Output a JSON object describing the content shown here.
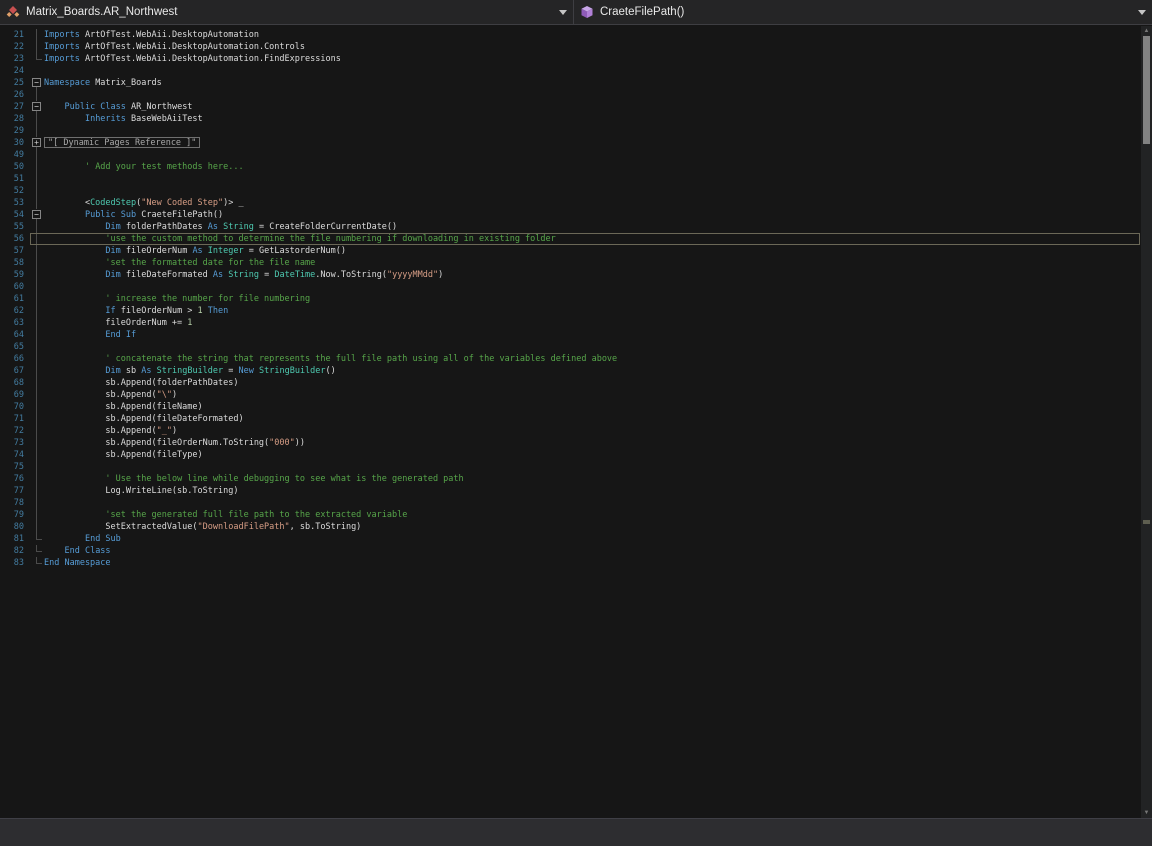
{
  "navbar": {
    "left": {
      "label": "Matrix_Boards.AR_Northwest",
      "icon": "class-icon"
    },
    "right": {
      "label": "CraeteFilePath()",
      "icon": "method-icon"
    }
  },
  "colors": {
    "keyword": "#569cd6",
    "type": "#4ec9b0",
    "string": "#d69d85",
    "comment": "#57a64a",
    "number": "#b5cea8",
    "plain": "#dcdcdc",
    "line_number": "#437ca0",
    "current_line_border": "#6b6857",
    "editor_background": "#161616"
  },
  "editor": {
    "current_line": 56,
    "collapsed_region_text": "\"[ Dynamic Pages Reference ]\"",
    "lines": [
      {
        "num": 21,
        "fold": "line",
        "segs": [
          [
            "k",
            "Imports "
          ],
          [
            "p",
            "ArtOfTest.WebAii.DesktopAutomation"
          ]
        ]
      },
      {
        "num": 22,
        "fold": "line",
        "segs": [
          [
            "k",
            "Imports "
          ],
          [
            "p",
            "ArtOfTest.WebAii.DesktopAutomation.Controls"
          ]
        ]
      },
      {
        "num": 23,
        "fold": "end",
        "segs": [
          [
            "k",
            "Imports "
          ],
          [
            "p",
            "ArtOfTest.WebAii.DesktopAutomation.FindExpressions"
          ]
        ]
      },
      {
        "num": 24,
        "fold": "none",
        "segs": []
      },
      {
        "num": 25,
        "fold": "minus",
        "segs": [
          [
            "k",
            "Namespace "
          ],
          [
            "p",
            "Matrix_Boards"
          ]
        ]
      },
      {
        "num": 26,
        "fold": "line",
        "segs": []
      },
      {
        "num": 27,
        "fold": "minus",
        "segs": [
          [
            "p",
            "    "
          ],
          [
            "k",
            "Public Class "
          ],
          [
            "p",
            "AR_Northwest"
          ]
        ]
      },
      {
        "num": 28,
        "fold": "line",
        "segs": [
          [
            "p",
            "        "
          ],
          [
            "k",
            "Inherits "
          ],
          [
            "p",
            "BaseWebAiiTest"
          ]
        ]
      },
      {
        "num": 29,
        "fold": "line",
        "segs": []
      },
      {
        "num": 30,
        "fold": "plus",
        "collapsed": true,
        "text": "\"[ Dynamic Pages Reference ]\""
      },
      {
        "num": 49,
        "fold": "line",
        "segs": []
      },
      {
        "num": 50,
        "fold": "line",
        "segs": [
          [
            "p",
            "        "
          ],
          [
            "c",
            "' Add your test methods here..."
          ]
        ]
      },
      {
        "num": 51,
        "fold": "line",
        "segs": []
      },
      {
        "num": 52,
        "fold": "line",
        "segs": []
      },
      {
        "num": 53,
        "fold": "line",
        "segs": [
          [
            "p",
            "        <"
          ],
          [
            "t",
            "CodedStep"
          ],
          [
            "p",
            "("
          ],
          [
            "s",
            "\"New Coded Step\""
          ],
          [
            "p",
            ")> _"
          ]
        ]
      },
      {
        "num": 54,
        "fold": "minus",
        "segs": [
          [
            "p",
            "        "
          ],
          [
            "k",
            "Public Sub "
          ],
          [
            "p",
            "CraeteFilePath()"
          ]
        ]
      },
      {
        "num": 55,
        "fold": "line",
        "segs": [
          [
            "p",
            "            "
          ],
          [
            "k",
            "Dim "
          ],
          [
            "p",
            "folderPathDates "
          ],
          [
            "k",
            "As "
          ],
          [
            "t",
            "String"
          ],
          [
            "p",
            " = CreateFolderCurrentDate()"
          ]
        ]
      },
      {
        "num": 56,
        "fold": "line",
        "current": true,
        "segs": [
          [
            "p",
            "            "
          ],
          [
            "c",
            "'use the custom method to determine the file numbering if downloading in existing folder"
          ]
        ]
      },
      {
        "num": 57,
        "fold": "line",
        "segs": [
          [
            "p",
            "            "
          ],
          [
            "k",
            "Dim "
          ],
          [
            "p",
            "fileOrderNum "
          ],
          [
            "k",
            "As "
          ],
          [
            "t",
            "Integer"
          ],
          [
            "p",
            " = GetLastorderNum()"
          ]
        ]
      },
      {
        "num": 58,
        "fold": "line",
        "segs": [
          [
            "p",
            "            "
          ],
          [
            "c",
            "'set the formatted date for the file name"
          ]
        ]
      },
      {
        "num": 59,
        "fold": "line",
        "segs": [
          [
            "p",
            "            "
          ],
          [
            "k",
            "Dim "
          ],
          [
            "p",
            "fileDateFormated "
          ],
          [
            "k",
            "As "
          ],
          [
            "t",
            "String"
          ],
          [
            "p",
            " = "
          ],
          [
            "t",
            "DateTime"
          ],
          [
            "p",
            ".Now.ToString("
          ],
          [
            "s",
            "\"yyyyMMdd\""
          ],
          [
            "p",
            ")"
          ]
        ]
      },
      {
        "num": 60,
        "fold": "line",
        "segs": []
      },
      {
        "num": 61,
        "fold": "line",
        "segs": [
          [
            "p",
            "            "
          ],
          [
            "c",
            "' increase the number for file numbering"
          ]
        ]
      },
      {
        "num": 62,
        "fold": "line",
        "segs": [
          [
            "p",
            "            "
          ],
          [
            "k",
            "If "
          ],
          [
            "p",
            "fileOrderNum > "
          ],
          [
            "n",
            "1"
          ],
          [
            "p",
            " "
          ],
          [
            "k",
            "Then"
          ]
        ]
      },
      {
        "num": 63,
        "fold": "line",
        "segs": [
          [
            "p",
            "            fileOrderNum += "
          ],
          [
            "n",
            "1"
          ]
        ]
      },
      {
        "num": 64,
        "fold": "line",
        "segs": [
          [
            "p",
            "            "
          ],
          [
            "k",
            "End If"
          ]
        ]
      },
      {
        "num": 65,
        "fold": "line",
        "segs": []
      },
      {
        "num": 66,
        "fold": "line",
        "segs": [
          [
            "p",
            "            "
          ],
          [
            "c",
            "' concatenate the string that represents the full file path using all of the variables defined above"
          ]
        ]
      },
      {
        "num": 67,
        "fold": "line",
        "segs": [
          [
            "p",
            "            "
          ],
          [
            "k",
            "Dim "
          ],
          [
            "p",
            "sb "
          ],
          [
            "k",
            "As "
          ],
          [
            "t",
            "StringBuilder"
          ],
          [
            "p",
            " = "
          ],
          [
            "k",
            "New "
          ],
          [
            "t",
            "StringBuilder"
          ],
          [
            "p",
            "()"
          ]
        ]
      },
      {
        "num": 68,
        "fold": "line",
        "segs": [
          [
            "p",
            "            sb.Append(folderPathDates)"
          ]
        ]
      },
      {
        "num": 69,
        "fold": "line",
        "segs": [
          [
            "p",
            "            sb.Append("
          ],
          [
            "s",
            "\"\\\""
          ],
          [
            "p",
            ")"
          ]
        ]
      },
      {
        "num": 70,
        "fold": "line",
        "segs": [
          [
            "p",
            "            sb.Append(fileName)"
          ]
        ]
      },
      {
        "num": 71,
        "fold": "line",
        "segs": [
          [
            "p",
            "            sb.Append(fileDateFormated)"
          ]
        ]
      },
      {
        "num": 72,
        "fold": "line",
        "segs": [
          [
            "p",
            "            sb.Append("
          ],
          [
            "s",
            "\"_\""
          ],
          [
            "p",
            ")"
          ]
        ]
      },
      {
        "num": 73,
        "fold": "line",
        "segs": [
          [
            "p",
            "            sb.Append(fileOrderNum.ToString("
          ],
          [
            "s",
            "\"000\""
          ],
          [
            "p",
            "))"
          ]
        ]
      },
      {
        "num": 74,
        "fold": "line",
        "segs": [
          [
            "p",
            "            sb.Append(fileType)"
          ]
        ]
      },
      {
        "num": 75,
        "fold": "line",
        "segs": []
      },
      {
        "num": 76,
        "fold": "line",
        "segs": [
          [
            "p",
            "            "
          ],
          [
            "c",
            "' Use the below line while debugging to see what is the generated path"
          ]
        ]
      },
      {
        "num": 77,
        "fold": "line",
        "segs": [
          [
            "p",
            "            Log.WriteLine(sb.ToString)"
          ]
        ]
      },
      {
        "num": 78,
        "fold": "line",
        "segs": []
      },
      {
        "num": 79,
        "fold": "line",
        "segs": [
          [
            "p",
            "            "
          ],
          [
            "c",
            "'set the generated full file path to the extracted variable"
          ]
        ]
      },
      {
        "num": 80,
        "fold": "line",
        "segs": [
          [
            "p",
            "            SetExtractedValue("
          ],
          [
            "s",
            "\"DownloadFilePath\""
          ],
          [
            "p",
            ", sb.ToString)"
          ]
        ]
      },
      {
        "num": 81,
        "fold": "end",
        "segs": [
          [
            "p",
            "        "
          ],
          [
            "k",
            "End Sub"
          ]
        ]
      },
      {
        "num": 82,
        "fold": "end",
        "segs": [
          [
            "p",
            "    "
          ],
          [
            "k",
            "End Class"
          ]
        ]
      },
      {
        "num": 83,
        "fold": "end",
        "segs": [
          [
            "k",
            "End Namespace"
          ]
        ]
      }
    ]
  }
}
